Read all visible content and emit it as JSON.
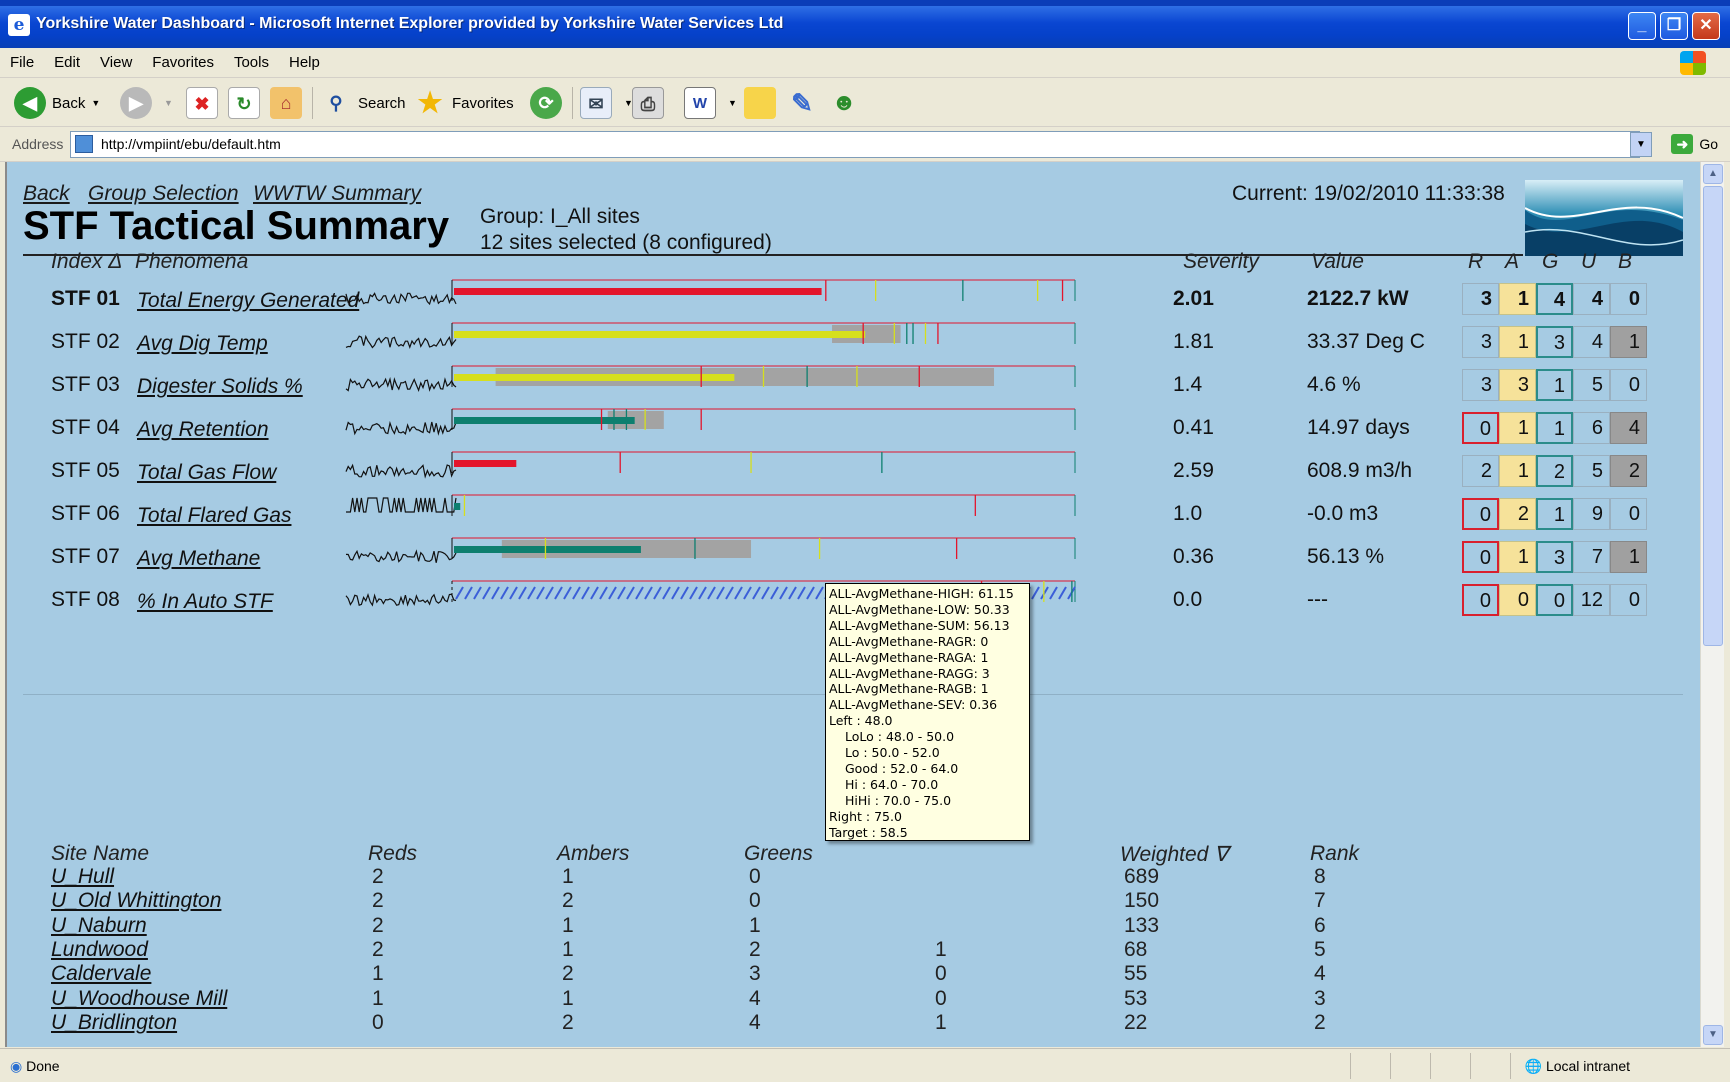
{
  "window": {
    "title": "Yorkshire Water Dashboard - Microsoft Internet Explorer provided by Yorkshire Water Services Ltd",
    "menu": [
      "File",
      "Edit",
      "View",
      "Favorites",
      "Tools",
      "Help"
    ],
    "toolbar": {
      "back": "Back",
      "search": "Search",
      "favorites": "Favorites"
    },
    "address_label": "Address",
    "url": "http://vmpiint/ebu/default.htm",
    "go": "Go",
    "status": "Done",
    "zone": "Local intranet"
  },
  "page": {
    "nav": [
      "Back",
      "Group Selection",
      "WWTW Summary"
    ],
    "title": "STF Tactical Summary",
    "group": "Group: I_All sites",
    "sites_selected": "12 sites selected (8 configured)",
    "current": "Current: 19/02/2010 11:33:38"
  },
  "stf_headers": {
    "index": "Index Δ",
    "phenomena": "Phenomena",
    "severity": "Severity",
    "value": "Value",
    "r": "R",
    "a": "A",
    "g": "G",
    "u": "U",
    "b": "B"
  },
  "stf_rows": [
    {
      "id": "STF 01",
      "name": "Total Energy Generated",
      "severity": "2.01",
      "value": "2122.7 kW",
      "r": "3",
      "a": "1",
      "g": "4",
      "u": "4",
      "b": "0",
      "bar_level": 0.59,
      "bar_color": "#e3152c",
      "range": [
        0,
        0
      ],
      "b_style": "plain",
      "r_style": "plain"
    },
    {
      "id": "STF 02",
      "name": "Avg Dig Temp",
      "severity": "1.81",
      "value": "33.37 Deg C",
      "r": "3",
      "a": "1",
      "g": "3",
      "u": "4",
      "b": "1",
      "bar_level": 0.66,
      "bar_color": "#d6df1d",
      "range": [
        0.61,
        0.72
      ],
      "b_style": "b",
      "r_style": "plain"
    },
    {
      "id": "STF 03",
      "name": "Digester Solids %",
      "severity": "1.4",
      "value": "4.6 %",
      "r": "3",
      "a": "3",
      "g": "1",
      "u": "5",
      "b": "0",
      "bar_level": 0.45,
      "bar_color": "#d6df1d",
      "range": [
        0.07,
        0.87
      ],
      "b_style": "plain",
      "r_style": "plain"
    },
    {
      "id": "STF 04",
      "name": "Avg Retention",
      "severity": "0.41",
      "value": "14.97 days",
      "r": "0",
      "a": "1",
      "g": "1",
      "u": "6",
      "b": "4",
      "bar_level": 0.29,
      "bar_color": "#0e7f6f",
      "range": [
        0.25,
        0.34
      ],
      "b_style": "b",
      "r_style": "r"
    },
    {
      "id": "STF 05",
      "name": "Total Gas Flow",
      "severity": "2.59",
      "value": "608.9 m3/h",
      "r": "2",
      "a": "1",
      "g": "2",
      "u": "5",
      "b": "2",
      "bar_level": 0.1,
      "bar_color": "#e3152c",
      "range": [
        0,
        0
      ],
      "b_style": "b",
      "r_style": "plain"
    },
    {
      "id": "STF 06",
      "name": "Total Flared Gas",
      "severity": "1.0",
      "value": "-0.0 m3",
      "r": "0",
      "a": "2",
      "g": "1",
      "u": "9",
      "b": "0",
      "bar_level": 0.01,
      "bar_color": "#0e7f6f",
      "range": [
        0,
        0
      ],
      "b_style": "plain",
      "r_style": "r"
    },
    {
      "id": "STF 07",
      "name": "Avg Methane",
      "severity": "0.36",
      "value": "56.13 %",
      "r": "0",
      "a": "1",
      "g": "3",
      "u": "7",
      "b": "1",
      "bar_level": 0.3,
      "bar_color": "#0e7f6f",
      "range": [
        0.08,
        0.48
      ],
      "b_style": "b",
      "r_style": "r"
    },
    {
      "id": "STF 08",
      "name": "% In Auto STF",
      "severity": "0.0",
      "value": "---",
      "r": "0",
      "a": "0",
      "g": "0",
      "u": "12",
      "b": "0",
      "bar_level": 0,
      "bar_color": "#3b5ed8",
      "range": [
        0,
        0
      ],
      "b_style": "plain",
      "r_style": "r",
      "hatched": true
    }
  ],
  "tooltip": {
    "lines": [
      "ALL-AvgMethane-HIGH: 61.15",
      "ALL-AvgMethane-LOW: 50.33",
      "ALL-AvgMethane-SUM: 56.13",
      "ALL-AvgMethane-RAGR: 0",
      "ALL-AvgMethane-RAGA: 1",
      "ALL-AvgMethane-RAGG: 3",
      "ALL-AvgMethane-RAGB: 1",
      "ALL-AvgMethane-SEV: 0.36",
      "Left : 48.0"
    ],
    "bands": [
      "LoLo : 48.0 - 50.0",
      "Lo : 50.0 - 52.0",
      "Good : 52.0 - 64.0",
      "Hi : 64.0 - 70.0",
      "HiHi : 70.0 - 75.0"
    ],
    "tail": [
      "Right : 75.0",
      "Target : 58.5"
    ]
  },
  "site_headers": {
    "site": "Site Name",
    "reds": "Reds",
    "ambers": "Ambers",
    "greens": "Greens",
    "weighted": "Weighted ∇",
    "rank": "Rank"
  },
  "sites": [
    {
      "name": "U_Hull",
      "reds": "2",
      "ambers": "1",
      "greens": "0",
      "fourth": "",
      "weighted": "689",
      "rank": "8"
    },
    {
      "name": "U_Old Whittington",
      "reds": "2",
      "ambers": "2",
      "greens": "0",
      "fourth": "",
      "weighted": "150",
      "rank": "7"
    },
    {
      "name": "U_Naburn",
      "reds": "2",
      "ambers": "1",
      "greens": "1",
      "fourth": "",
      "weighted": "133",
      "rank": "6"
    },
    {
      "name": "Lundwood",
      "reds": "2",
      "ambers": "1",
      "greens": "2",
      "fourth": "1",
      "weighted": "68",
      "rank": "5"
    },
    {
      "name": "Caldervale",
      "reds": "1",
      "ambers": "2",
      "greens": "3",
      "fourth": "0",
      "weighted": "55",
      "rank": "4"
    },
    {
      "name": "U_Woodhouse Mill",
      "reds": "1",
      "ambers": "1",
      "greens": "4",
      "fourth": "0",
      "weighted": "53",
      "rank": "3"
    },
    {
      "name": "U_Bridlington",
      "reds": "0",
      "ambers": "2",
      "greens": "4",
      "fourth": "1",
      "weighted": "22",
      "rank": "2"
    }
  ],
  "colors": {
    "red": "#e3152c",
    "amber": "#d6df1d",
    "green": "#0e7f6f",
    "page_bg": "#a6cbe3"
  }
}
